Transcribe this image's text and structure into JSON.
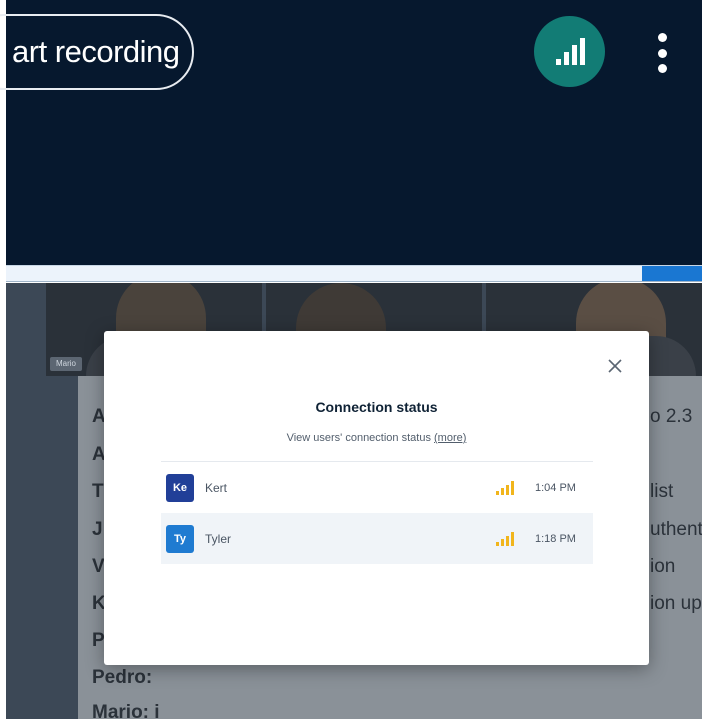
{
  "header": {
    "record_label": "art recording",
    "connection_icon": "signal-bars-icon",
    "menu_icon": "kebab-menu-icon",
    "accent_color": "#127c75"
  },
  "background": {
    "video_tiles": [
      {
        "label": "Mario"
      },
      {
        "label": ""
      },
      {
        "label": ""
      }
    ],
    "document_lines_left": [
      "A",
      "A",
      "T",
      "J",
      "V",
      "K",
      "P",
      "Pedro:",
      "Mario: i"
    ],
    "document_lines_right": [
      "o 2.3",
      "",
      "list",
      "uthent",
      "ion",
      "ion up"
    ]
  },
  "modal": {
    "title": "Connection status",
    "subtitle": "View users' connection status",
    "more_link": "(more)",
    "users": [
      {
        "initials": "Ke",
        "name": "Kert",
        "time": "1:04 PM",
        "avatar_color": "#213f98",
        "signal_color": "#f1b51c"
      },
      {
        "initials": "Ty",
        "name": "Tyler",
        "time": "1:18 PM",
        "avatar_color": "#1f7bd1",
        "signal_color": "#f1b51c"
      }
    ]
  }
}
